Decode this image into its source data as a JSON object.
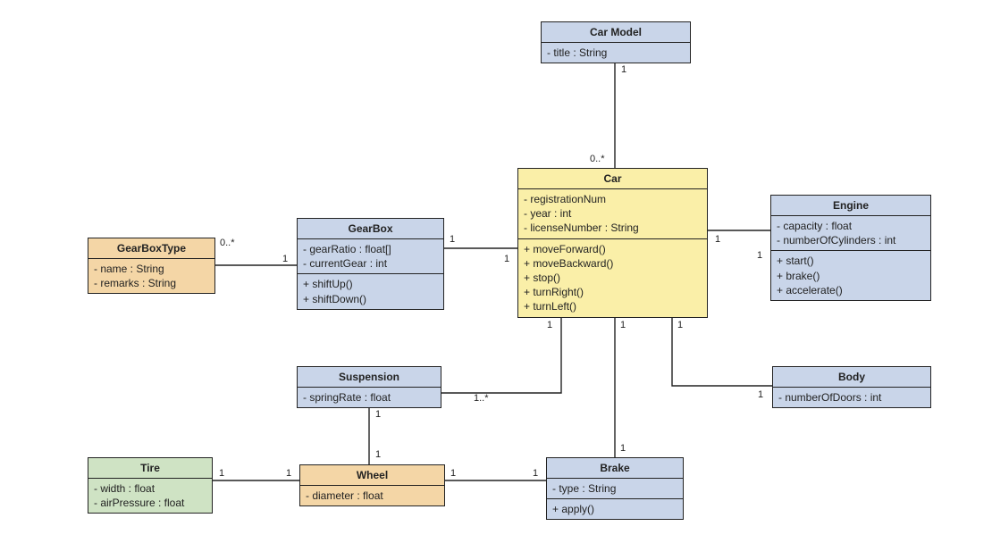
{
  "diagram_type": "UML Class Diagram",
  "classes": {
    "carModel": {
      "name": "Car Model",
      "attributes": [
        "- title : String"
      ],
      "methods": []
    },
    "gearBoxType": {
      "name": "GearBoxType",
      "attributes": [
        "- name : String",
        "- remarks : String"
      ],
      "methods": []
    },
    "gearBox": {
      "name": "GearBox",
      "attributes": [
        "- gearRatio : float[]",
        "- currentGear : int"
      ],
      "methods": [
        "+ shiftUp()",
        "+ shiftDown()"
      ]
    },
    "car": {
      "name": "Car",
      "attributes": [
        "- registrationNum",
        "- year : int",
        "- licenseNumber : String"
      ],
      "methods": [
        "+ moveForward()",
        "+ moveBackward()",
        "+ stop()",
        "+ turnRight()",
        "+ turnLeft()"
      ]
    },
    "engine": {
      "name": "Engine",
      "attributes": [
        "- capacity : float",
        "- numberOfCylinders : int"
      ],
      "methods": [
        "+ start()",
        "+ brake()",
        "+ accelerate()"
      ]
    },
    "suspension": {
      "name": "Suspension",
      "attributes": [
        "- springRate : float"
      ],
      "methods": []
    },
    "body": {
      "name": "Body",
      "attributes": [
        "- numberOfDoors : int"
      ],
      "methods": []
    },
    "tire": {
      "name": "Tire",
      "attributes": [
        "- width : float",
        "- airPressure : float"
      ],
      "methods": []
    },
    "wheel": {
      "name": "Wheel",
      "attributes": [
        "- diameter : float"
      ],
      "methods": []
    },
    "brake": {
      "name": "Brake",
      "attributes": [
        "- type : String"
      ],
      "methods": [
        "+ apply()"
      ]
    }
  },
  "associations": [
    {
      "from": "Car Model",
      "to": "Car",
      "mult_from": "1",
      "mult_to": "0..*"
    },
    {
      "from": "GearBoxType",
      "to": "GearBox",
      "mult_from": "1",
      "mult_to": "0..*"
    },
    {
      "from": "GearBox",
      "to": "Car",
      "mult_from": "1",
      "mult_to": "1"
    },
    {
      "from": "Car",
      "to": "Engine",
      "mult_from": "1",
      "mult_to": "1"
    },
    {
      "from": "Car",
      "to": "Suspension",
      "mult_from": "1",
      "mult_to": "1..*"
    },
    {
      "from": "Car",
      "to": "Brake",
      "mult_from": "1",
      "mult_to": "1"
    },
    {
      "from": "Car",
      "to": "Body",
      "mult_from": "1",
      "mult_to": "1"
    },
    {
      "from": "Suspension",
      "to": "Wheel",
      "mult_from": "1",
      "mult_to": "1"
    },
    {
      "from": "Wheel",
      "to": "Brake",
      "mult_from": "1",
      "mult_to": "1"
    },
    {
      "from": "Wheel",
      "to": "Tire",
      "mult_from": "1",
      "mult_to": "1"
    }
  ],
  "m": {
    "carModel_car_1": "1",
    "carModel_car_0n": "0..*",
    "gbt_gb_0n": "0..*",
    "gbt_gb_1": "1",
    "gb_car_1a": "1",
    "gb_car_1b": "1",
    "car_eng_1a": "1",
    "car_eng_1b": "1",
    "car_susp_1": "1",
    "car_susp_n": "1..*",
    "car_brake_1a": "1",
    "car_brake_1b": "1",
    "car_body_1a": "1",
    "car_body_1b": "1",
    "susp_wheel_1a": "1",
    "susp_wheel_1b": "1",
    "wheel_brake_1a": "1",
    "wheel_brake_1b": "1",
    "wheel_tire_1a": "1",
    "wheel_tire_1b": "1"
  }
}
